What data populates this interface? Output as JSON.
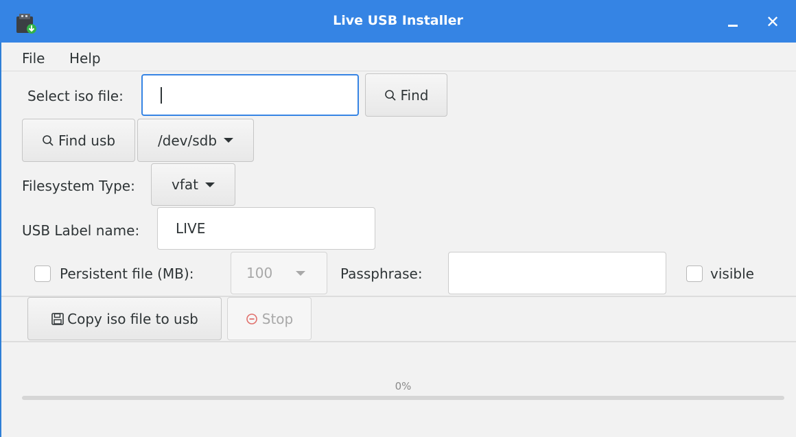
{
  "window": {
    "title": "Live USB Installer"
  },
  "menu": {
    "file": "File",
    "help": "Help"
  },
  "iso": {
    "label": "Select iso file:",
    "value": "",
    "find_label": "Find"
  },
  "usb": {
    "find_usb_label": "Find usb",
    "device": "/dev/sdb"
  },
  "filesystem": {
    "label": "Filesystem Type:",
    "value": "vfat"
  },
  "usb_label": {
    "label": "USB Label name:",
    "value": "LIVE"
  },
  "persistent": {
    "label": "Persistent file (MB):",
    "checked": false,
    "value": "100"
  },
  "passphrase": {
    "label": "Passphrase:",
    "value": "",
    "visible_label": "visible",
    "visible_checked": false
  },
  "actions": {
    "copy_label": "Copy iso file to usb",
    "stop_label": "Stop"
  },
  "progress": {
    "text": "0%",
    "value": 0
  },
  "colors": {
    "accent": "#3584e4"
  }
}
